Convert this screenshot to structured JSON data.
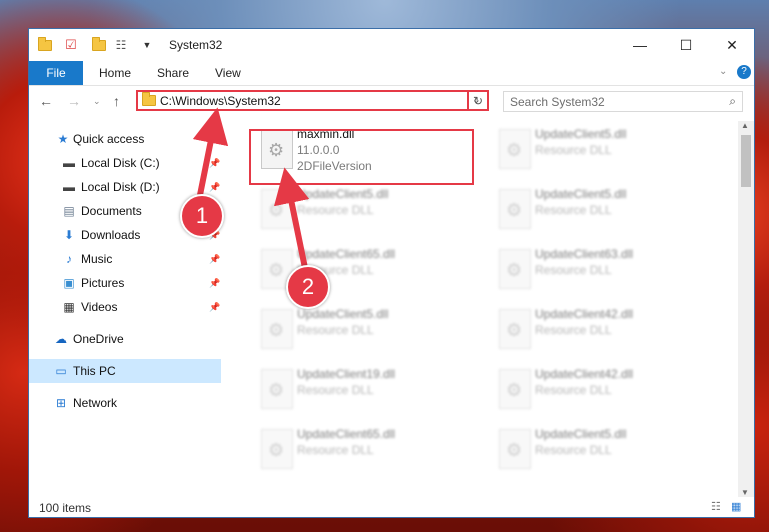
{
  "window": {
    "title": "System32"
  },
  "ribbon": {
    "file": "File",
    "home": "Home",
    "share": "Share",
    "view": "View"
  },
  "address": {
    "path": "C:\\Windows\\System32",
    "search_placeholder": "Search System32"
  },
  "sidebar": {
    "items": [
      {
        "label": "Quick access",
        "icon": "star-icon"
      },
      {
        "label": "Local Disk (C:)",
        "icon": "drive-icon"
      },
      {
        "label": "Local Disk (D:)",
        "icon": "drive-icon"
      },
      {
        "label": "Documents",
        "icon": "documents-icon"
      },
      {
        "label": "Downloads",
        "icon": "downloads-icon"
      },
      {
        "label": "Music",
        "icon": "music-icon"
      },
      {
        "label": "Pictures",
        "icon": "pictures-icon"
      },
      {
        "label": "Videos",
        "icon": "videos-icon"
      },
      {
        "label": "OneDrive",
        "icon": "cloud-icon"
      },
      {
        "label": "This PC",
        "icon": "computer-icon"
      },
      {
        "label": "Network",
        "icon": "network-icon"
      }
    ]
  },
  "files": {
    "featured": {
      "name": "maxmin.dll",
      "version": "11.0.0.0",
      "description": "2DFileVersion"
    },
    "left": [
      {
        "name": "UpdateClient5.dll",
        "type": "Resource DLL"
      },
      {
        "name": "UpdateClient65.dll",
        "type": "Resource DLL"
      },
      {
        "name": "UpdateClient5.dll",
        "type": "Resource DLL"
      },
      {
        "name": "UpdateClient19.dll",
        "type": "Resource DLL"
      },
      {
        "name": "UpdateClient65.dll",
        "type": "Resource DLL"
      }
    ],
    "right": [
      {
        "name": "UpdateClient5.dll",
        "type": "Resource DLL"
      },
      {
        "name": "UpdateClient5.dll",
        "type": "Resource DLL"
      },
      {
        "name": "UpdateClient63.dll",
        "type": "Resource DLL"
      },
      {
        "name": "UpdateClient42.dll",
        "type": "Resource DLL"
      },
      {
        "name": "UpdateClient42.dll",
        "type": "Resource DLL"
      },
      {
        "name": "UpdateClient5.dll",
        "type": "Resource DLL"
      }
    ]
  },
  "status": {
    "count": "100 items"
  },
  "annotations": {
    "step1": "1",
    "step2": "2"
  }
}
